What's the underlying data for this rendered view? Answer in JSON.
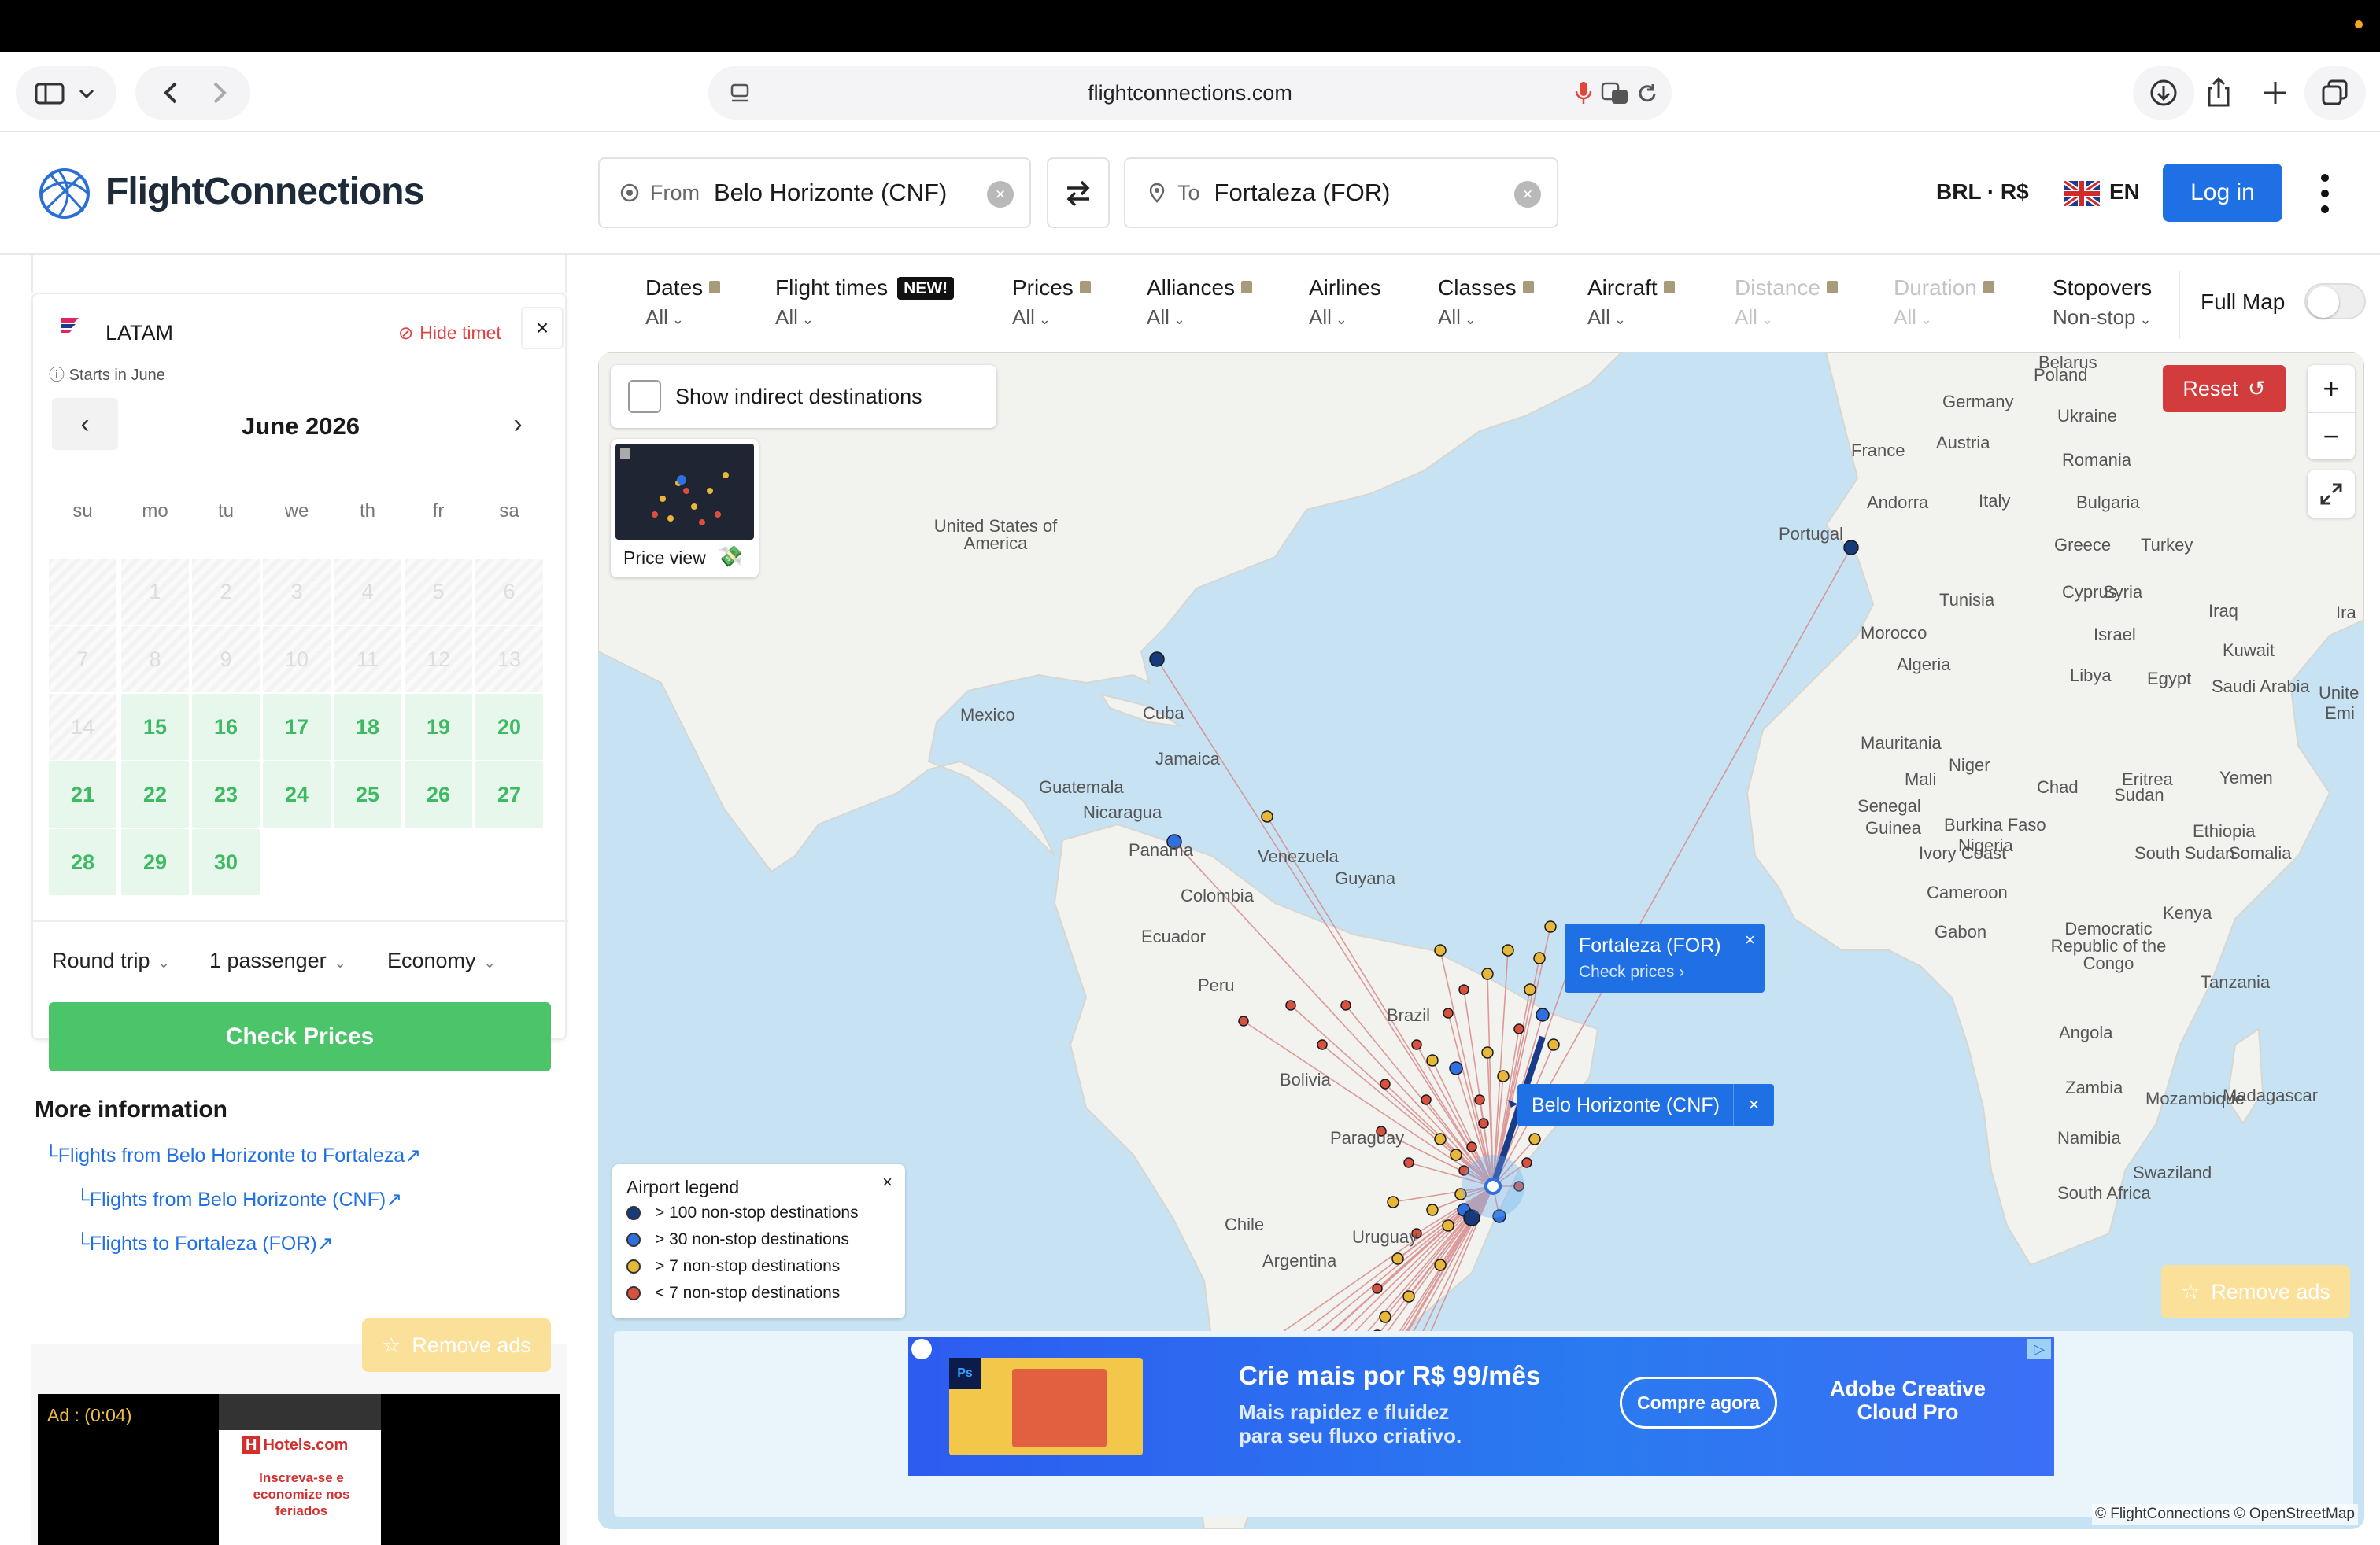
{
  "browser": {
    "url": "flightconnections.com"
  },
  "header": {
    "logo_text": "FlightConnections",
    "from_label": "From",
    "from_value": "Belo Horizonte (CNF)",
    "to_label": "To",
    "to_value": "Fortaleza (FOR)",
    "currency": "BRL · R$",
    "language": "EN",
    "login_label": "Log in"
  },
  "schedule": {
    "airline": "LATAM",
    "hide_label": "Hide timet",
    "starts_note": "Starts in June",
    "month_title": "June 2026",
    "weekdays": [
      "su",
      "mo",
      "tu",
      "we",
      "th",
      "fr",
      "sa"
    ],
    "days": [
      "1",
      "2",
      "3",
      "4",
      "5",
      "6",
      "7",
      "8",
      "9",
      "10",
      "11",
      "12",
      "13",
      "14",
      "15",
      "16",
      "17",
      "18",
      "19",
      "20",
      "21",
      "22",
      "23",
      "24",
      "25",
      "26",
      "27",
      "28",
      "29",
      "30"
    ],
    "trip_type": "Round trip",
    "passengers": "1 passenger",
    "cabin": "Economy",
    "check_prices": "Check Prices"
  },
  "more_info": {
    "title": "More information",
    "links": [
      "Flights from Belo Horizonte to Fortaleza",
      "Flights from Belo Horizonte (CNF)",
      "Flights to Fortaleza (FOR)"
    ]
  },
  "remove_ads_label": "Remove ads",
  "video_ad": {
    "timer": "Ad : (0:04)",
    "brand": "Hotels.com",
    "message": "Inscreva-se e economize nos feriados"
  },
  "filters": [
    {
      "title": "Dates",
      "value": "All",
      "locked": true,
      "disabled": false
    },
    {
      "title": "Flight times",
      "value": "All",
      "badge": "NEW!",
      "locked": false,
      "disabled": false
    },
    {
      "title": "Prices",
      "value": "All",
      "locked": true,
      "disabled": false
    },
    {
      "title": "Alliances",
      "value": "All",
      "locked": true,
      "disabled": false
    },
    {
      "title": "Airlines",
      "value": "All",
      "locked": false,
      "disabled": false
    },
    {
      "title": "Classes",
      "value": "All",
      "locked": true,
      "disabled": false
    },
    {
      "title": "Aircraft",
      "value": "All",
      "locked": true,
      "disabled": false
    },
    {
      "title": "Distance",
      "value": "All",
      "locked": true,
      "disabled": true
    },
    {
      "title": "Duration",
      "value": "All",
      "locked": true,
      "disabled": true
    },
    {
      "title": "Stopovers",
      "value": "Non-stop",
      "locked": false,
      "disabled": false
    }
  ],
  "full_map_label": "Full Map",
  "map": {
    "indirect_label": "Show indirect destinations",
    "price_view_label": "Price view",
    "reset_label": "Reset",
    "callout_dest": "Fortaleza (FOR)",
    "callout_check": "Check prices",
    "callout_origin": "Belo Horizonte (CNF)",
    "legend_title": "Airport legend",
    "legend_items": [
      "> 100 non-stop destinations",
      "> 30 non-stop destinations",
      "> 7 non-stop destinations",
      "< 7 non-stop destinations"
    ],
    "legend_colors": [
      "#173a7a",
      "#2f6fe0",
      "#e7b73a",
      "#d9503f"
    ],
    "attribution": "© FlightConnections © OpenStreetMap",
    "labels": [
      "Germany",
      "Poland",
      "Belarus",
      "France",
      "Austria",
      "Romania",
      "Ukraine",
      "Andorra",
      "Italy",
      "Bulgaria",
      "Portugal",
      "Greece",
      "Turkey",
      "United States of America",
      "Cyprus",
      "Syria",
      "Iraq",
      "Tunisia",
      "Israel",
      "Morocco",
      "Algeria",
      "Libya",
      "Egypt",
      "Kuwait",
      "Saudi Arabia",
      "Mexico",
      "Cuba",
      "Jamaica",
      "Mauritania",
      "Guatemala",
      "Mali",
      "Niger",
      "Chad",
      "Sudan",
      "Eritrea",
      "Yemen",
      "Nicaragua",
      "Senegal",
      "Guinea",
      "Burkina Faso",
      "Nigeria",
      "Ethiopia",
      "Panama",
      "Ivory Coast",
      "South Sudan",
      "Somalia",
      "Venezuela",
      "Guyana",
      "Colombia",
      "Cameroon",
      "Ecuador",
      "Gabon",
      "Democratic Republic of the Congo",
      "Kenya",
      "Peru",
      "Brazil",
      "Tanzania",
      "Angola",
      "Bolivia",
      "Zambia",
      "Mozambique",
      "Madagascar",
      "Paraguay",
      "Namibia",
      "Swaziland",
      "South Africa",
      "Chile",
      "Uruguay",
      "Argentina",
      "Unite",
      "Emi",
      "Ira"
    ]
  },
  "banner_ad": {
    "headline": "Crie mais por R$ 99/mês",
    "sub": "Mais rapidez e fluidez para seu fluxo criativo.",
    "cta": "Compre agora",
    "product": "Adobe Creative Cloud Pro"
  }
}
